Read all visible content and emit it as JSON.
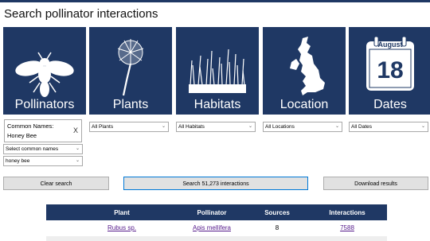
{
  "page": {
    "title": "Search pollinator interactions"
  },
  "tiles": [
    {
      "label": "Pollinators",
      "icon": "bee-icon"
    },
    {
      "label": "Plants",
      "icon": "dandelion-icon"
    },
    {
      "label": "Habitats",
      "icon": "grass-icon"
    },
    {
      "label": "Location",
      "icon": "uk-map-icon"
    },
    {
      "label": "Dates",
      "icon": "calendar-icon",
      "month": "August",
      "day": "18"
    }
  ],
  "filters": {
    "common_names_label": "Common Names:",
    "common_names_value": "Honey Bee",
    "clear_x": "X",
    "select_common_names": "Select common names",
    "search_value": "honey bee",
    "plants": "All Plants",
    "habitats": "All Habitats",
    "locations": "All Locations",
    "dates": "All Dates"
  },
  "actions": {
    "clear": "Clear search",
    "search": "Search 51,273 interactions",
    "download": "Download results"
  },
  "table": {
    "headers": [
      "Plant",
      "Pollinator",
      "Sources",
      "Interactions"
    ],
    "rows": [
      {
        "plant": "Rubus sp.",
        "pollinator": "Apis mellifera",
        "sources": "8",
        "interactions": "7588"
      }
    ]
  },
  "colors": {
    "navy": "#1f3864",
    "link": "#551a8b",
    "focus": "#0078d7"
  }
}
